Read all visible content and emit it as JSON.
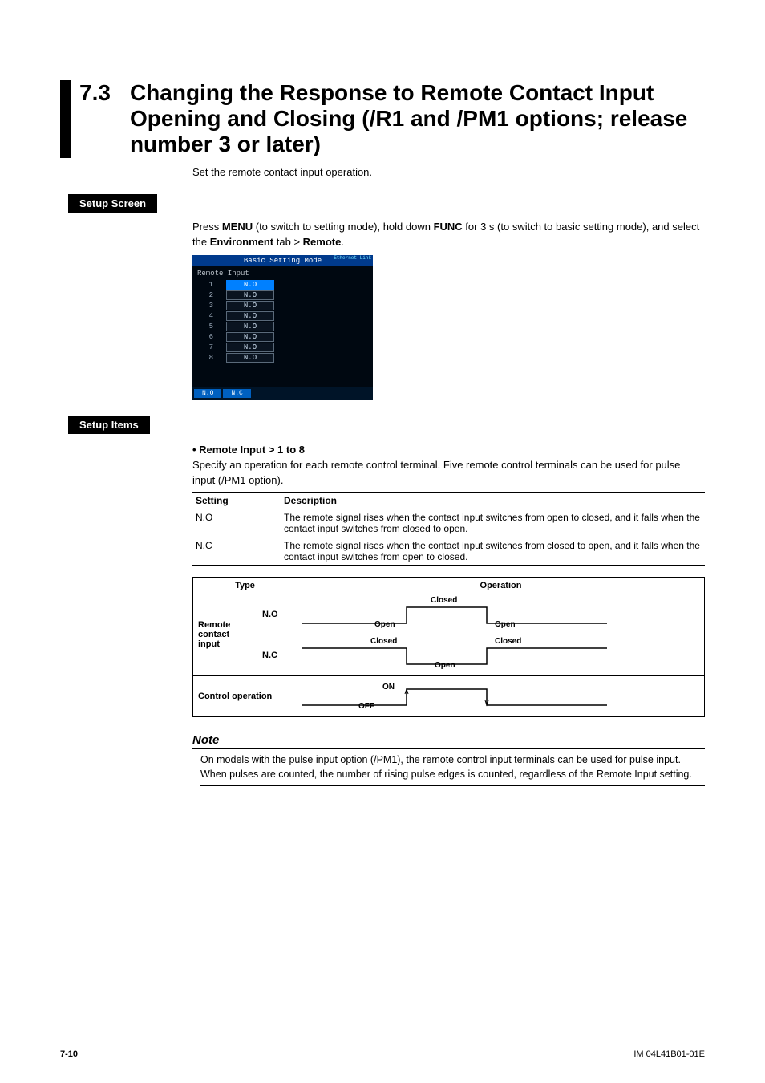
{
  "section": {
    "number": "7.3",
    "title": "Changing the Response to Remote Contact Input Opening and Closing (/R1 and /PM1 options; release number 3 or later)",
    "intro": "Set the remote contact input operation."
  },
  "setupScreen": {
    "heading": "Setup Screen",
    "line_pre": "Press ",
    "menu": "MENU",
    "line_mid1": " (to switch to setting mode), hold down ",
    "func": "FUNC",
    "line_mid2": " for 3 s (to switch to basic setting mode), and select the ",
    "env": "Environment",
    "line_mid3": " tab > ",
    "remote": "Remote",
    "line_end": "."
  },
  "device": {
    "header": "Basic Setting Mode",
    "ethernet": "Ethernet Link",
    "subtitle": "Remote Input",
    "rows": [
      {
        "n": "1",
        "v": "N.O",
        "sel": true
      },
      {
        "n": "2",
        "v": "N.O",
        "sel": false
      },
      {
        "n": "3",
        "v": "N.O",
        "sel": false
      },
      {
        "n": "4",
        "v": "N.O",
        "sel": false
      },
      {
        "n": "5",
        "v": "N.O",
        "sel": false
      },
      {
        "n": "6",
        "v": "N.O",
        "sel": false
      },
      {
        "n": "7",
        "v": "N.O",
        "sel": false
      },
      {
        "n": "8",
        "v": "N.O",
        "sel": false
      }
    ],
    "footer": [
      "N.O",
      "N.C"
    ]
  },
  "setupItems": {
    "heading": "Setup Items",
    "bullet": "• Remote Input > 1 to 8",
    "text": "Specify an operation for each remote control terminal. Five remote control terminals can be used for pulse input (/PM1 option)."
  },
  "settingsTable": {
    "h1": "Setting",
    "h2": "Description",
    "rows": [
      {
        "s": "N.O",
        "d": "The remote signal rises when the contact input switches from open to closed, and it falls when the contact input switches from closed to open."
      },
      {
        "s": "N.C",
        "d": "The remote signal rises when the contact input switches from closed to open, and it falls when the contact input switches from open to closed."
      }
    ]
  },
  "opTable": {
    "h_type": "Type",
    "h_op": "Operation",
    "row_label": "Remote contact input",
    "no": "N.O",
    "nc": "N.C",
    "ctrl": "Control operation",
    "labels": {
      "open": "Open",
      "closed": "Closed",
      "on": "ON",
      "off": "OFF"
    }
  },
  "note": {
    "head": "Note",
    "body": "On models with the pulse input option (/PM1), the remote control input terminals can be used for pulse input. When pulses are counted, the number of rising pulse edges is counted, regardless of the Remote Input setting."
  },
  "footer": {
    "page": "7-10",
    "doc": "IM 04L41B01-01E"
  }
}
